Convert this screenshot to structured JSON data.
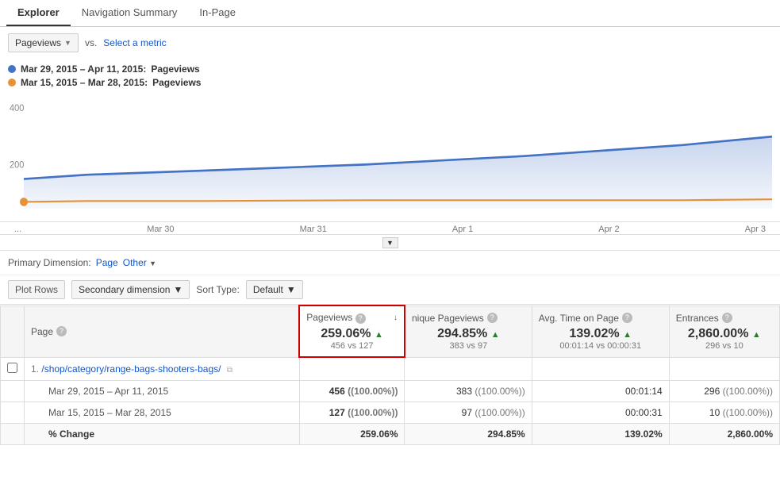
{
  "tabs": [
    {
      "id": "explorer",
      "label": "Explorer",
      "active": true
    },
    {
      "id": "navigation-summary",
      "label": "Navigation Summary",
      "active": false
    },
    {
      "id": "in-page",
      "label": "In-Page",
      "active": false
    }
  ],
  "toolbar": {
    "metric_dropdown": "Pageviews",
    "vs_label": "vs.",
    "select_metric_label": "Select a metric"
  },
  "legend": [
    {
      "id": "blue",
      "date_range": "Mar 29, 2015 – Apr 11, 2015:",
      "metric": "Pageviews",
      "color": "blue"
    },
    {
      "id": "orange",
      "date_range": "Mar 15, 2015 – Mar 28, 2015:",
      "metric": "Pageviews",
      "color": "orange"
    }
  ],
  "chart": {
    "y_label_400": "400",
    "y_label_200": "200",
    "x_labels": [
      "...",
      "Mar 30",
      "Mar 31",
      "Apr 1",
      "Apr 2",
      "Apr 3"
    ]
  },
  "primary_dimension": {
    "label": "Primary Dimension:",
    "page_label": "Page",
    "other_label": "Other"
  },
  "table_toolbar": {
    "plot_rows_label": "Plot Rows",
    "secondary_dim_label": "Secondary dimension",
    "sort_type_label": "Sort Type:",
    "default_label": "Default"
  },
  "table": {
    "columns": [
      {
        "id": "page",
        "label": "Page",
        "has_help": true
      },
      {
        "id": "pageviews",
        "label": "Pageviews",
        "has_help": true,
        "sortable": true,
        "highlighted": true
      },
      {
        "id": "unique-pageviews",
        "label": "nique Pageviews",
        "has_help": true
      },
      {
        "id": "avg-time",
        "label": "Avg. Time on Page",
        "has_help": true
      },
      {
        "id": "entrances",
        "label": "Entrances",
        "has_help": true
      }
    ],
    "summary_row": {
      "pageviews_pct": "259.06%",
      "pageviews_green": true,
      "pageviews_sub": "456 vs 127",
      "unique_pct": "294.85%",
      "unique_green": true,
      "unique_sub": "383 vs 97",
      "avg_time_pct": "139.02%",
      "avg_time_green": true,
      "avg_time_sub": "00:01:14 vs 00:00:31",
      "entrances_pct": "2,860.00%",
      "entrances_green": true,
      "entrances_sub": "296 vs 10"
    },
    "rows": [
      {
        "num": "1.",
        "page": "/shop/category/range-bags-shooters-bags/",
        "has_copy": true,
        "pageviews_r1": "456",
        "pageviews_r1_pct": "(100.00%)",
        "unique_r1": "383",
        "unique_r1_pct": "(100.00%)",
        "avg_time_r1": "00:01:14",
        "entrances_r1": "296",
        "entrances_r1_pct": "(100.00%)",
        "date1_label": "Mar 29, 2015 – Apr 11, 2015",
        "date2_label": "Mar 15, 2015 – Mar 28, 2015",
        "pageviews_r2": "127",
        "pageviews_r2_pct": "(100.00%)",
        "unique_r2": "97",
        "unique_r2_pct": "(100.00%)",
        "avg_time_r2": "00:00:31",
        "entrances_r2": "10",
        "entrances_r2_pct": "(100.00%)",
        "pct_change_pageviews": "259.06%",
        "pct_change_unique": "294.85%",
        "pct_change_avg": "139.02%",
        "pct_change_entrances": "2,860.00%"
      }
    ]
  }
}
